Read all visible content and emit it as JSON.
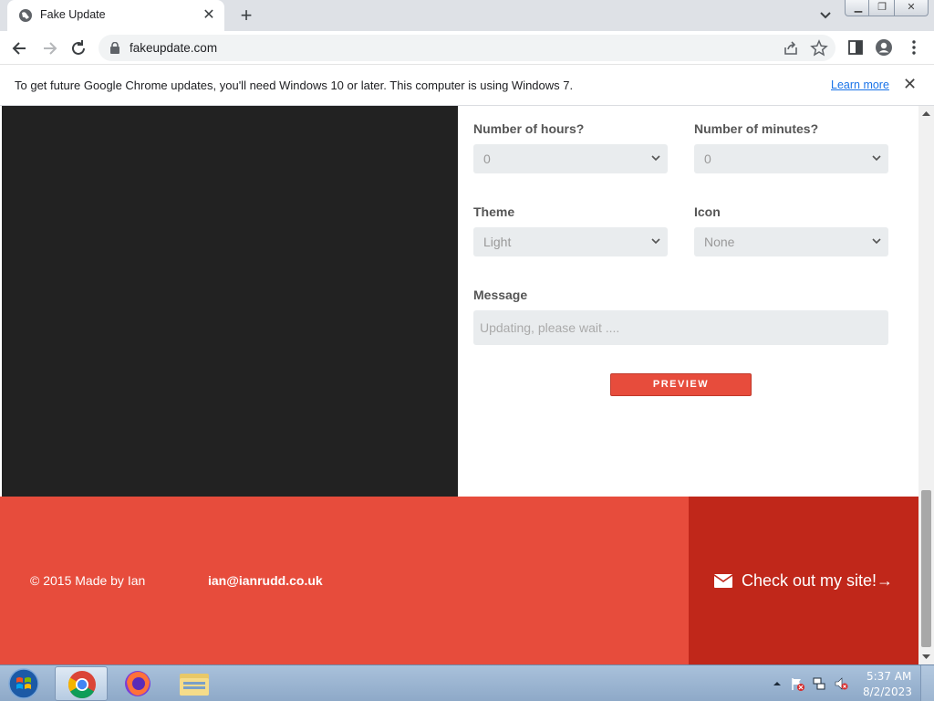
{
  "browser": {
    "tab_title": "Fake Update",
    "url": "fakeupdate.com",
    "infobar": {
      "message": "To get future Google Chrome updates, you'll need Windows 10 or later. This computer is using Windows 7.",
      "link": "Learn more"
    }
  },
  "form": {
    "hours": {
      "label": "Number of hours?",
      "value": "0"
    },
    "minutes": {
      "label": "Number of minutes?",
      "value": "0"
    },
    "theme": {
      "label": "Theme",
      "value": "Light"
    },
    "icon": {
      "label": "Icon",
      "value": "None"
    },
    "message": {
      "label": "Message",
      "placeholder": "Updating, please wait ...."
    },
    "preview_button": "PREVIEW"
  },
  "footer": {
    "copyright": "© 2015 Made by Ian",
    "email": "ian@ianrudd.co.uk",
    "cta": "Check out my site!→"
  },
  "taskbar": {
    "time": "5:37 AM",
    "date": "8/2/2023"
  },
  "colors": {
    "accent": "#e74c3c",
    "accent_dark": "#c0271a",
    "dark_panel": "#222222"
  }
}
